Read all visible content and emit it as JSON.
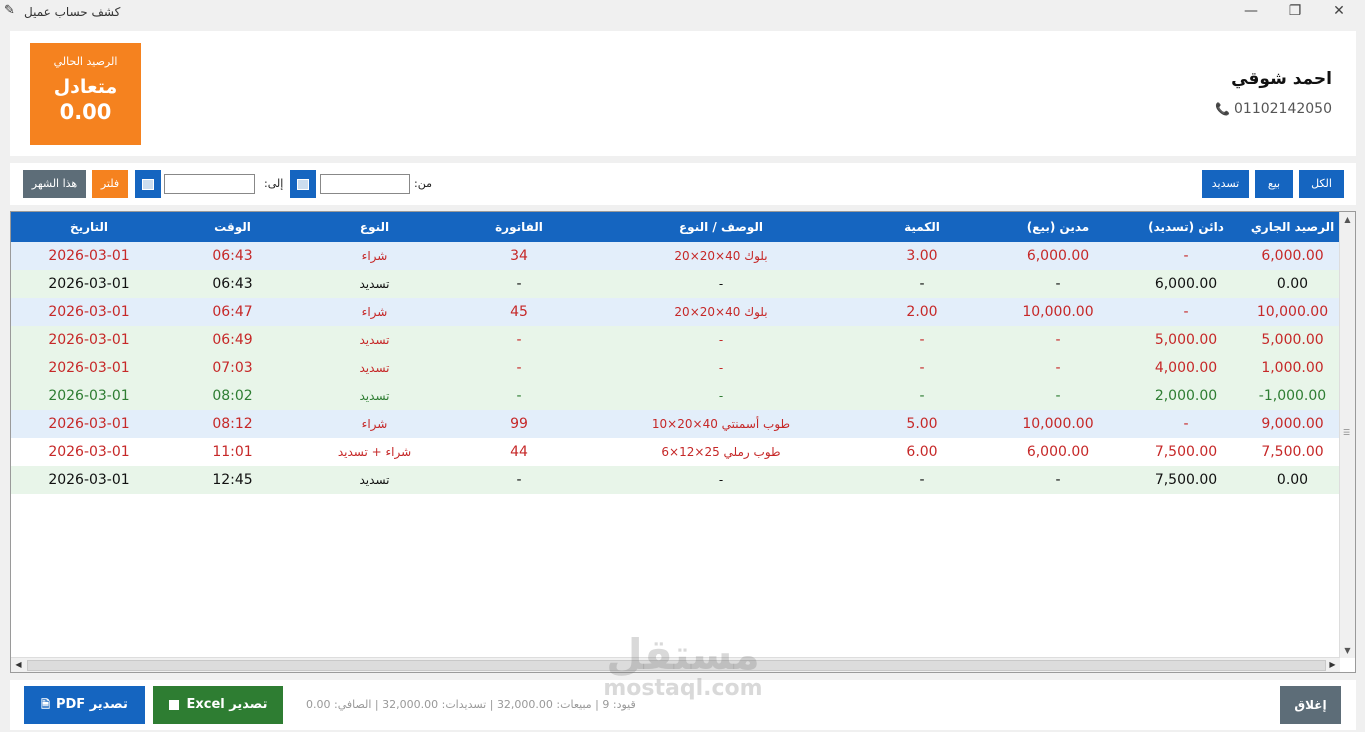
{
  "window": {
    "title": "كشف حساب عميل"
  },
  "balance": {
    "label": "الرصيد الحالي",
    "status": "متعادل",
    "amount": "0.00"
  },
  "customer": {
    "name": "احمد شوقي",
    "phone": "01102142050"
  },
  "filters": {
    "all": "الكل",
    "sale": "بيع",
    "payment": "تسديد",
    "from_label": ":من",
    "to_label": ":إلى",
    "from_value": "",
    "to_value": "",
    "filter": "فلتر",
    "this_month": "هذا الشهر"
  },
  "table": {
    "headers": [
      "الرصيد الجاري",
      "دائن (تسديد)",
      "مدين (بيع)",
      "الكمية",
      "الوصف / النوع",
      "الفاتورة",
      "النوع",
      "الوقت",
      "التاريخ"
    ],
    "rows": [
      [
        "6,000.00",
        "-",
        "6,000.00",
        "3.00",
        "بلوك 40×20×20",
        "34",
        "شراء",
        "06:43",
        "2026-03-01"
      ],
      [
        "0.00",
        "6,000.00",
        "-",
        "-",
        "-",
        "-",
        "تسديد",
        "06:43",
        "2026-03-01"
      ],
      [
        "10,000.00",
        "-",
        "10,000.00",
        "2.00",
        "بلوك 40×20×20",
        "45",
        "شراء",
        "06:47",
        "2026-03-01"
      ],
      [
        "5,000.00",
        "5,000.00",
        "-",
        "-",
        "-",
        "-",
        "تسديد",
        "06:49",
        "2026-03-01"
      ],
      [
        "1,000.00",
        "4,000.00",
        "-",
        "-",
        "-",
        "-",
        "تسديد",
        "07:03",
        "2026-03-01"
      ],
      [
        "-1,000.00",
        "2,000.00",
        "-",
        "-",
        "-",
        "-",
        "تسديد",
        "08:02",
        "2026-03-01"
      ],
      [
        "9,000.00",
        "-",
        "10,000.00",
        "5.00",
        "طوب أسمنتي 40×20×10",
        "99",
        "شراء",
        "08:12",
        "2026-03-01"
      ],
      [
        "7,500.00",
        "7,500.00",
        "6,000.00",
        "6.00",
        "طوب رملي 25×12×6",
        "44",
        "شراء + تسديد",
        "11:01",
        "2026-03-01"
      ],
      [
        "0.00",
        "7,500.00",
        "-",
        "-",
        "-",
        "-",
        "تسديد",
        "12:45",
        "2026-03-01"
      ]
    ]
  },
  "footer": {
    "close": "إغلاق",
    "summary": "قيود: 9 | مبيعات: 32,000.00 | تسديدات: 32,000.00 | الصافي: 0.00",
    "excel": "Excel تصدير",
    "pdf": "PDF تصدير"
  },
  "watermark": {
    "arabic": "مستقل",
    "latin": "mostaql.com"
  },
  "colors": {
    "primary_blue": "#1565c0",
    "orange": "#f5821f",
    "excel_green": "#2e7d32",
    "close_gray": "#5d6d78",
    "buy_row": "#e3eefa",
    "payment_row": "#e8f5e9",
    "negative_red": "#c62828"
  }
}
